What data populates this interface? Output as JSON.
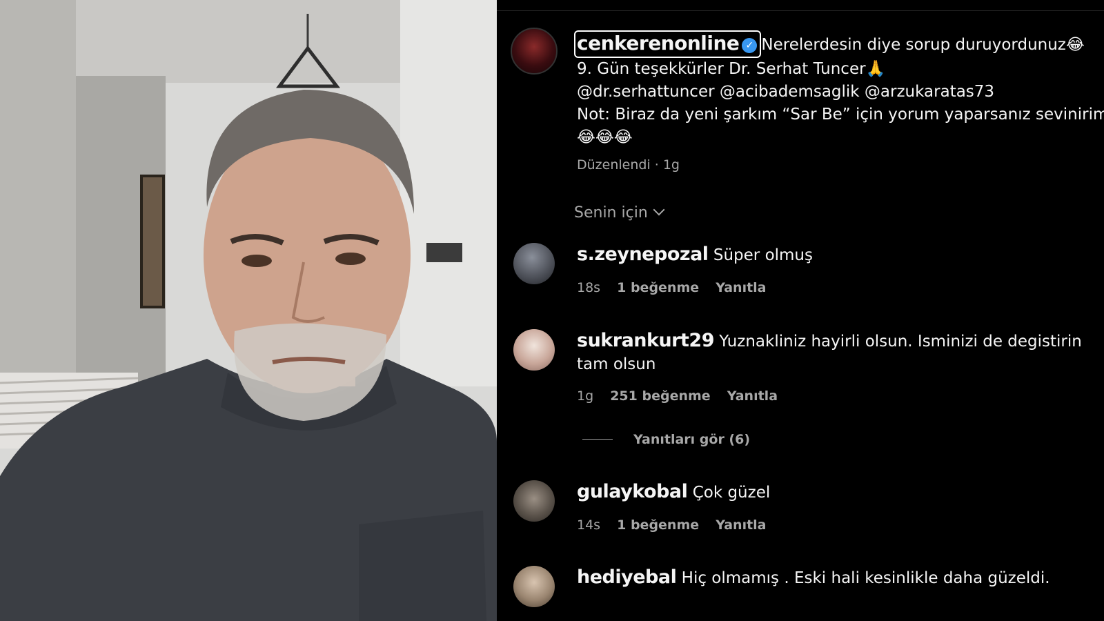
{
  "post": {
    "username": "cenkerenonline",
    "caption_line1": "Nerelerdesin diye sorup duruyordunuz😂",
    "caption_line2": "9. Gün teşekkürler Dr. Serhat Tuncer🙏",
    "caption_line3": "@dr.serhattuncer @acibademsaglik @arzukaratas73",
    "caption_line4": "Not: Biraz da yeni şarkım “Sar Be” için yorum yaparsanız sevinirim",
    "caption_line5": "😂😂😂",
    "edited_text": "Düzenlendi · 1g"
  },
  "sort": {
    "label": "Senin için"
  },
  "comments": [
    {
      "username": "s.zeynepozal",
      "text": "Süper olmuş",
      "time": "18s",
      "likes": "1 beğenme",
      "reply": "Yanıtla"
    },
    {
      "username": "sukrankurt29",
      "text": "Yuznakliniz hayirli olsun. Isminizi de degistirin tam olsun",
      "time": "1g",
      "likes": "251 beğenme",
      "reply": "Yanıtla",
      "view_replies": "Yanıtları gör (6)"
    },
    {
      "username": "gulaykobal",
      "text": "Çok güzel",
      "time": "14s",
      "likes": "1 beğenme",
      "reply": "Yanıtla"
    },
    {
      "username": "hediyebal",
      "text": "Hiç olmamış . Eski hali kesinlikle daha güzeldi.",
      "time": "",
      "likes": "",
      "reply": ""
    }
  ],
  "colors": {
    "background": "#000000",
    "text": "#f5f5f5",
    "muted": "#a8a8a8",
    "verified": "#3897f0"
  }
}
